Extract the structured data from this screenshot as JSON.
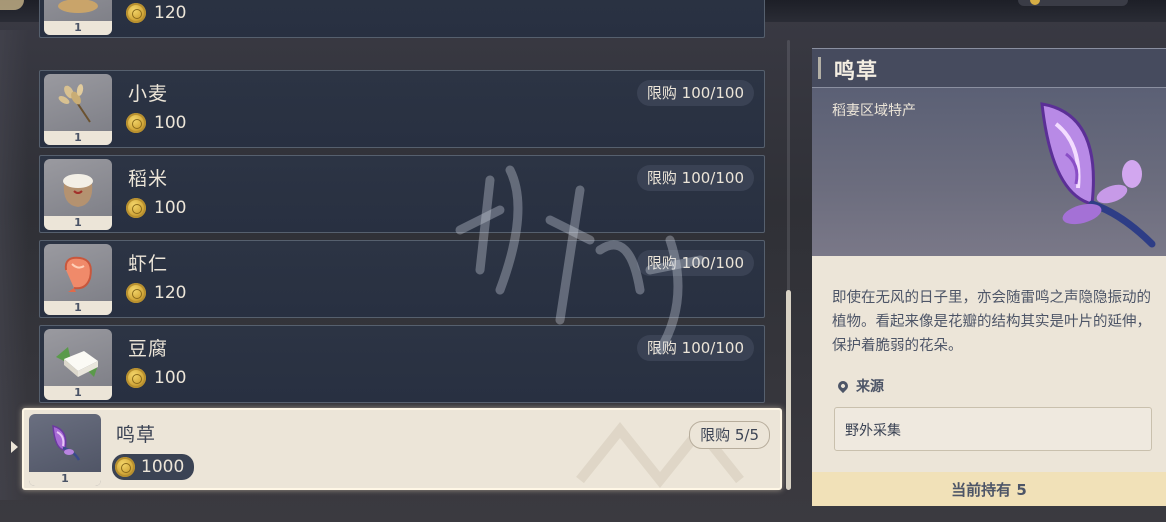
{
  "goods": [
    {
      "name": "",
      "price": "120",
      "limit": "",
      "count": "1",
      "icon": "dish-icon"
    },
    {
      "name": "小麦",
      "price": "100",
      "limit": "限购 100/100",
      "count": "1",
      "icon": "wheat-icon"
    },
    {
      "name": "稻米",
      "price": "100",
      "limit": "限购 100/100",
      "count": "1",
      "icon": "rice-sack-icon"
    },
    {
      "name": "虾仁",
      "price": "120",
      "limit": "限购 100/100",
      "count": "1",
      "icon": "shrimp-icon"
    },
    {
      "name": "豆腐",
      "price": "100",
      "limit": "限购 100/100",
      "count": "1",
      "icon": "tofu-icon"
    }
  ],
  "selected": {
    "name": "鸣草",
    "price": "1000",
    "limit": "限购 5/5",
    "count": "1",
    "icon": "naku-weed-icon"
  },
  "detail": {
    "title": "鸣草",
    "type": "稻妻区域特产",
    "description": "即使在无风的日子里，亦会随雷鸣之声隐隐振动的植物。看起来像是花瓣的结构其实是叶片的延伸，保护着脆弱的花朵。",
    "source_label": "来源",
    "source": "野外采集",
    "owned": "当前持有 5"
  },
  "colors": {
    "accent": "#ece5d8",
    "card": "#2c3444",
    "currency": "#d3a83a"
  }
}
